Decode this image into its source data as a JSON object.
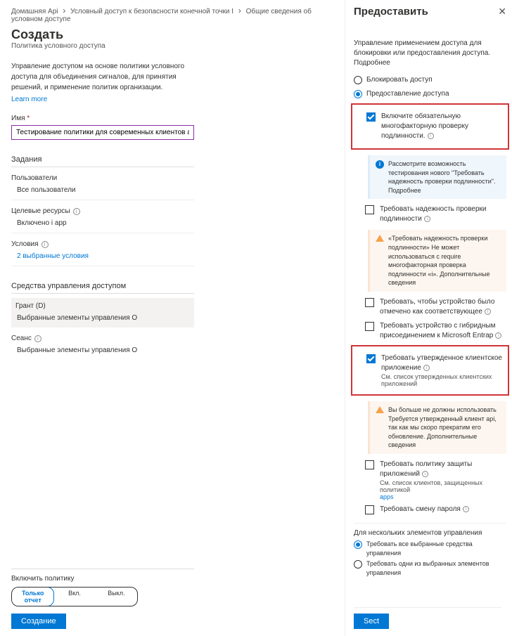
{
  "breadcrumb": {
    "home": "Домашняя Api",
    "mid": "Условный доступ к безопасности конечной точки I",
    "current": "Общие сведения об условном доступе"
  },
  "page": {
    "title": "Создать",
    "subtitle": "Политика условного доступа",
    "desc": "Управление доступом на основе политики условного доступа для объединения сигналов, для принятия решений, и применение политик организации.",
    "learn_more": "Learn more"
  },
  "name_field": {
    "label": "Имя",
    "value": "Тестирование политики для современных клиентов auth"
  },
  "assignments": {
    "header": "Задания",
    "users_label": "Пользователи",
    "users_value": "Все пользователи",
    "resources_label": "Целевые ресурсы",
    "resources_value": "Включено i app",
    "conditions_label": "Условия",
    "conditions_value": "2 выбранные условия"
  },
  "access_controls": {
    "header": "Средства управления доступом",
    "grant_label": "Грант (D)",
    "grant_value": "Выбранные элементы управления O",
    "session_label": "Сеанс",
    "session_value": "Выбранные элементы управления O"
  },
  "enable_policy": {
    "label": "Включить политику",
    "opts": [
      "Только отчет",
      "Вкл.",
      "Выкл."
    ],
    "create_btn": "Создание"
  },
  "right": {
    "title": "Предоставить",
    "desc": "Управление применением доступа для блокировки или предоставления доступа.",
    "more": "Подробнее",
    "radio_block": "Блокировать доступ",
    "radio_grant": "Предоставление доступа",
    "chk_mfa": "Включите обязательную многофакторную проверку подлинности.",
    "callout_info": "Рассмотрите возможность тестирования нового \"Требовать надежность проверки подлинности\". Подробнее",
    "chk_auth_strength": "Требовать надежность проверки подлинности",
    "callout_warn1": "«Требовать надежность проверки подлинности» Не может использоваться с require многофакторная проверка подлинности «i». Дополнительные сведения",
    "chk_compliant": "Требовать, чтобы устройство было отмечено как соответствующее",
    "chk_hybrid": "Требовать устройство с гибридным присоединением к Microsoft Entrap",
    "chk_approved": "Требовать утвержденное клиентское приложение",
    "approved_sub": "См. список утвержденных клиентских приложений",
    "callout_warn2": "Вы больше не должны использовать Требуется утвержденный клиент api, так как мы скоро прекратим его обновление. Дополнительные сведения",
    "chk_app_protect": "Требовать политику защиты приложений",
    "app_protect_sub1": "См. список клиентов, защищенных политикой",
    "app_protect_sub2": "apps",
    "chk_pwchange": "Требовать смену пароля",
    "multi_header": "Для нескольких элементов управления",
    "radio_all": "Требовать все выбранные средства управления",
    "radio_one": "Требовать одни из выбранных элементов управления",
    "select_btn": "Sect"
  }
}
